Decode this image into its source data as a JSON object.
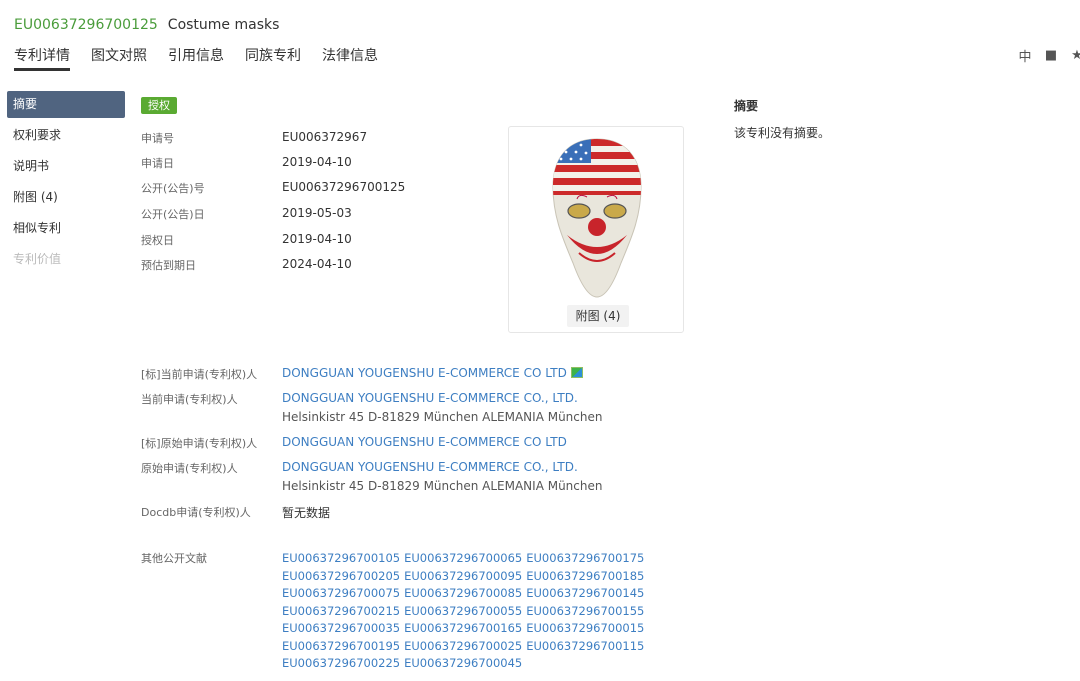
{
  "header": {
    "pub_no": "EU00637296700125",
    "title": "Costume masks"
  },
  "tabs": [
    "专利详情",
    "图文对照",
    "引用信息",
    "同族专利",
    "法律信息"
  ],
  "toolbar": {
    "icons": [
      "translate-icon",
      "folder-icon",
      "star-icon"
    ],
    "glyphs": [
      "中",
      "■",
      "★"
    ]
  },
  "sidenav": [
    "摘要",
    "权利要求",
    "说明书",
    "附图 (4)",
    "相似专利",
    "专利价值"
  ],
  "status_badge": "授权",
  "fields": [
    {
      "label": "申请号",
      "value": "EU006372967"
    },
    {
      "label": "申请日",
      "value": "2019-04-10"
    },
    {
      "label": "公开(公告)号",
      "value": "EU00637296700125"
    },
    {
      "label": "公开(公告)日",
      "value": "2019-05-03"
    },
    {
      "label": "授权日",
      "value": "2019-04-10"
    },
    {
      "label": "预估到期日",
      "value": "2024-04-10"
    }
  ],
  "figure": {
    "label": "附图 (4)"
  },
  "abstract": {
    "title": "摘要",
    "text": "该专利没有摘要。"
  },
  "parties": {
    "std_current_label": "[标]当前申请(专利权)人",
    "std_current": "DONGGUAN YOUGENSHU E-COMMERCE CO LTD",
    "current_label": "当前申请(专利权)人",
    "current": "DONGGUAN YOUGENSHU E-COMMERCE CO., LTD.",
    "current_addr": "Helsinkistr 45 D-81829 München ALEMANIA München",
    "std_original_label": "[标]原始申请(专利权)人",
    "std_original": "DONGGUAN YOUGENSHU E-COMMERCE CO LTD",
    "original_label": "原始申请(专利权)人",
    "original": "DONGGUAN YOUGENSHU E-COMMERCE CO., LTD.",
    "original_addr": "Helsinkistr 45 D-81829 München ALEMANIA München",
    "docdb_label": "Docdb申请(专利权)人",
    "docdb": "暂无数据"
  },
  "other_docs_label": "其他公开文献",
  "other_docs": [
    "EU00637296700105",
    "EU00637296700065",
    "EU00637296700175",
    "EU00637296700205",
    "EU00637296700095",
    "EU00637296700185",
    "EU00637296700075",
    "EU00637296700085",
    "EU00637296700145",
    "EU00637296700215",
    "EU00637296700055",
    "EU00637296700155",
    "EU00637296700035",
    "EU00637296700165",
    "EU00637296700015",
    "EU00637296700195",
    "EU00637296700025",
    "EU00637296700115",
    "EU00637296700225",
    "EU00637296700045"
  ]
}
